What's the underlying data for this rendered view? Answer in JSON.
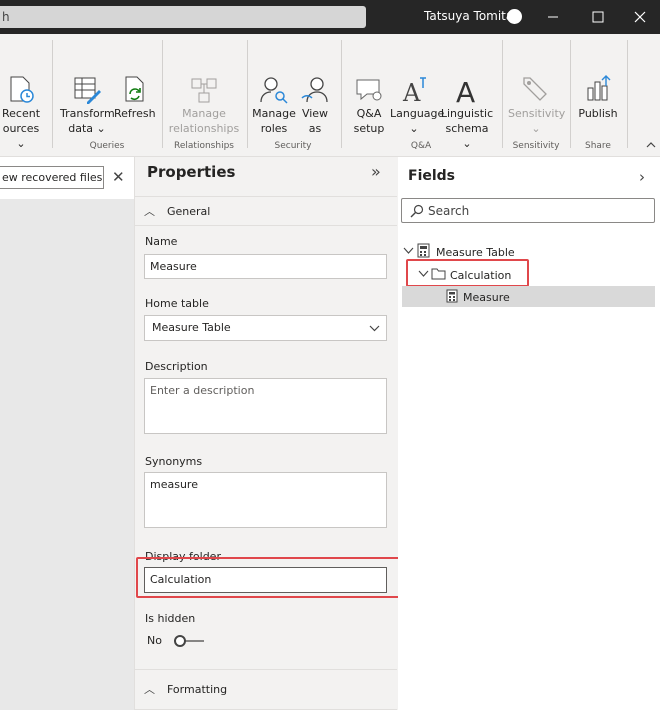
{
  "titlebar": {
    "search_text": "h",
    "user_name": "Tatsuya Tomita"
  },
  "ribbon": {
    "buttons": {
      "recent_sources": {
        "line1": "Recent",
        "line2": "ources"
      },
      "transform_data": {
        "line1": "Transform",
        "line2": "data"
      },
      "refresh": {
        "line1": "Refresh"
      },
      "manage_relationships": {
        "line1": "Manage",
        "line2": "relationships"
      },
      "manage_roles": {
        "line1": "Manage",
        "line2": "roles"
      },
      "view_as": {
        "line1": "View",
        "line2": "as"
      },
      "qa_setup": {
        "line1": "Q&A",
        "line2": "setup"
      },
      "language": {
        "line1": "Language"
      },
      "linguistic_schema": {
        "line1": "Linguistic",
        "line2": "schema"
      },
      "sensitivity": {
        "line1": "Sensitivity"
      },
      "publish": {
        "line1": "Publish"
      }
    },
    "groups": {
      "queries": "Queries",
      "relationships": "Relationships",
      "security": "Security",
      "qa": "Q&A",
      "sensitivity": "Sensitivity",
      "share": "Share"
    }
  },
  "recovery": {
    "button_label": "ew recovered files"
  },
  "properties": {
    "title": "Properties",
    "general_section": "General",
    "name_label": "Name",
    "name_value": "Measure",
    "home_table_label": "Home table",
    "home_table_value": "Measure Table",
    "description_label": "Description",
    "description_placeholder": "Enter a description",
    "synonyms_label": "Synonyms",
    "synonyms_value": "measure",
    "display_folder_label": "Display folder",
    "display_folder_value": "Calculation",
    "is_hidden_label": "Is hidden",
    "is_hidden_value": "No",
    "formatting_section": "Formatting"
  },
  "fields": {
    "title": "Fields",
    "search_placeholder": "Search",
    "tree": {
      "table": "Measure Table",
      "folder": "Calculation",
      "measure": "Measure"
    }
  },
  "colors": {
    "highlight": "#e0474b",
    "titlebar": "#262626",
    "ribbon": "#f3f2f1",
    "selected_row": "#d9d9d9"
  }
}
